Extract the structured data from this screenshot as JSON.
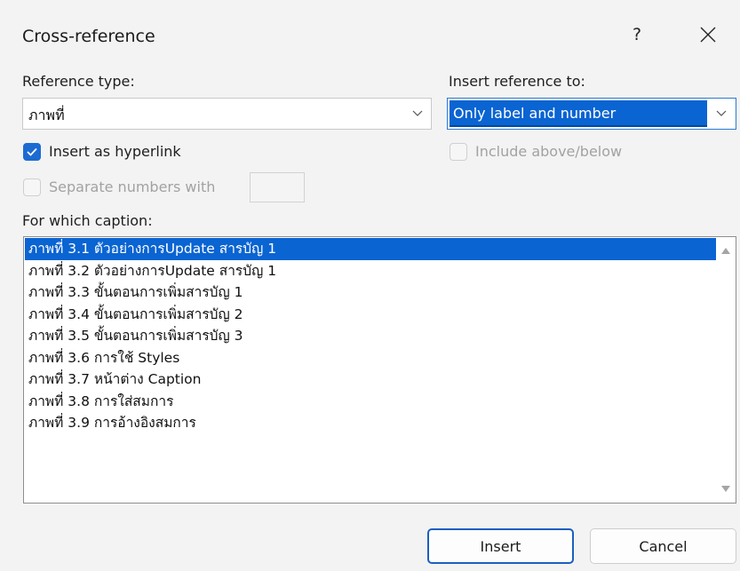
{
  "window": {
    "title": "Cross-reference",
    "help_label": "?"
  },
  "reference_type": {
    "label": "Reference type:",
    "selected": "ภาพที่"
  },
  "insert_reference_to": {
    "label": "Insert reference to:",
    "selected": "Only label and number"
  },
  "options": {
    "insert_as_hyperlink": {
      "label": "Insert as hyperlink",
      "checked": true
    },
    "include_above_below": {
      "label": "Include above/below",
      "checked": false,
      "enabled": false
    },
    "separate_numbers": {
      "label": "Separate numbers with",
      "checked": false,
      "enabled": false,
      "value": ""
    }
  },
  "caption_list": {
    "label": "For which caption:",
    "items": [
      "ภาพที่ 3.1 ตัวอย่างการUpdate สารบัญ 1",
      "ภาพที่ 3.2 ตัวอย่างการUpdate สารบัญ 1",
      "ภาพที่ 3.3 ขั้นตอนการเพิ่มสารบัญ 1",
      "ภาพที่ 3.4 ขั้นตอนการเพิ่มสารบัญ 2",
      "ภาพที่ 3.5 ขั้นตอนการเพิ่มสารบัญ 3",
      "ภาพที่ 3.6 การใช้ Styles",
      "ภาพที่ 3.7 หน้าต่าง Caption",
      "ภาพที่ 3.8 การใส่สมการ",
      "ภาพที่ 3.9 การอ้างอิงสมการ"
    ],
    "selected_index": 0
  },
  "buttons": {
    "insert": "Insert",
    "cancel": "Cancel"
  },
  "colors": {
    "accent": "#0a64d2",
    "checkbox_on": "#1c6bd2",
    "dialog_bg": "#f3f3f3"
  }
}
